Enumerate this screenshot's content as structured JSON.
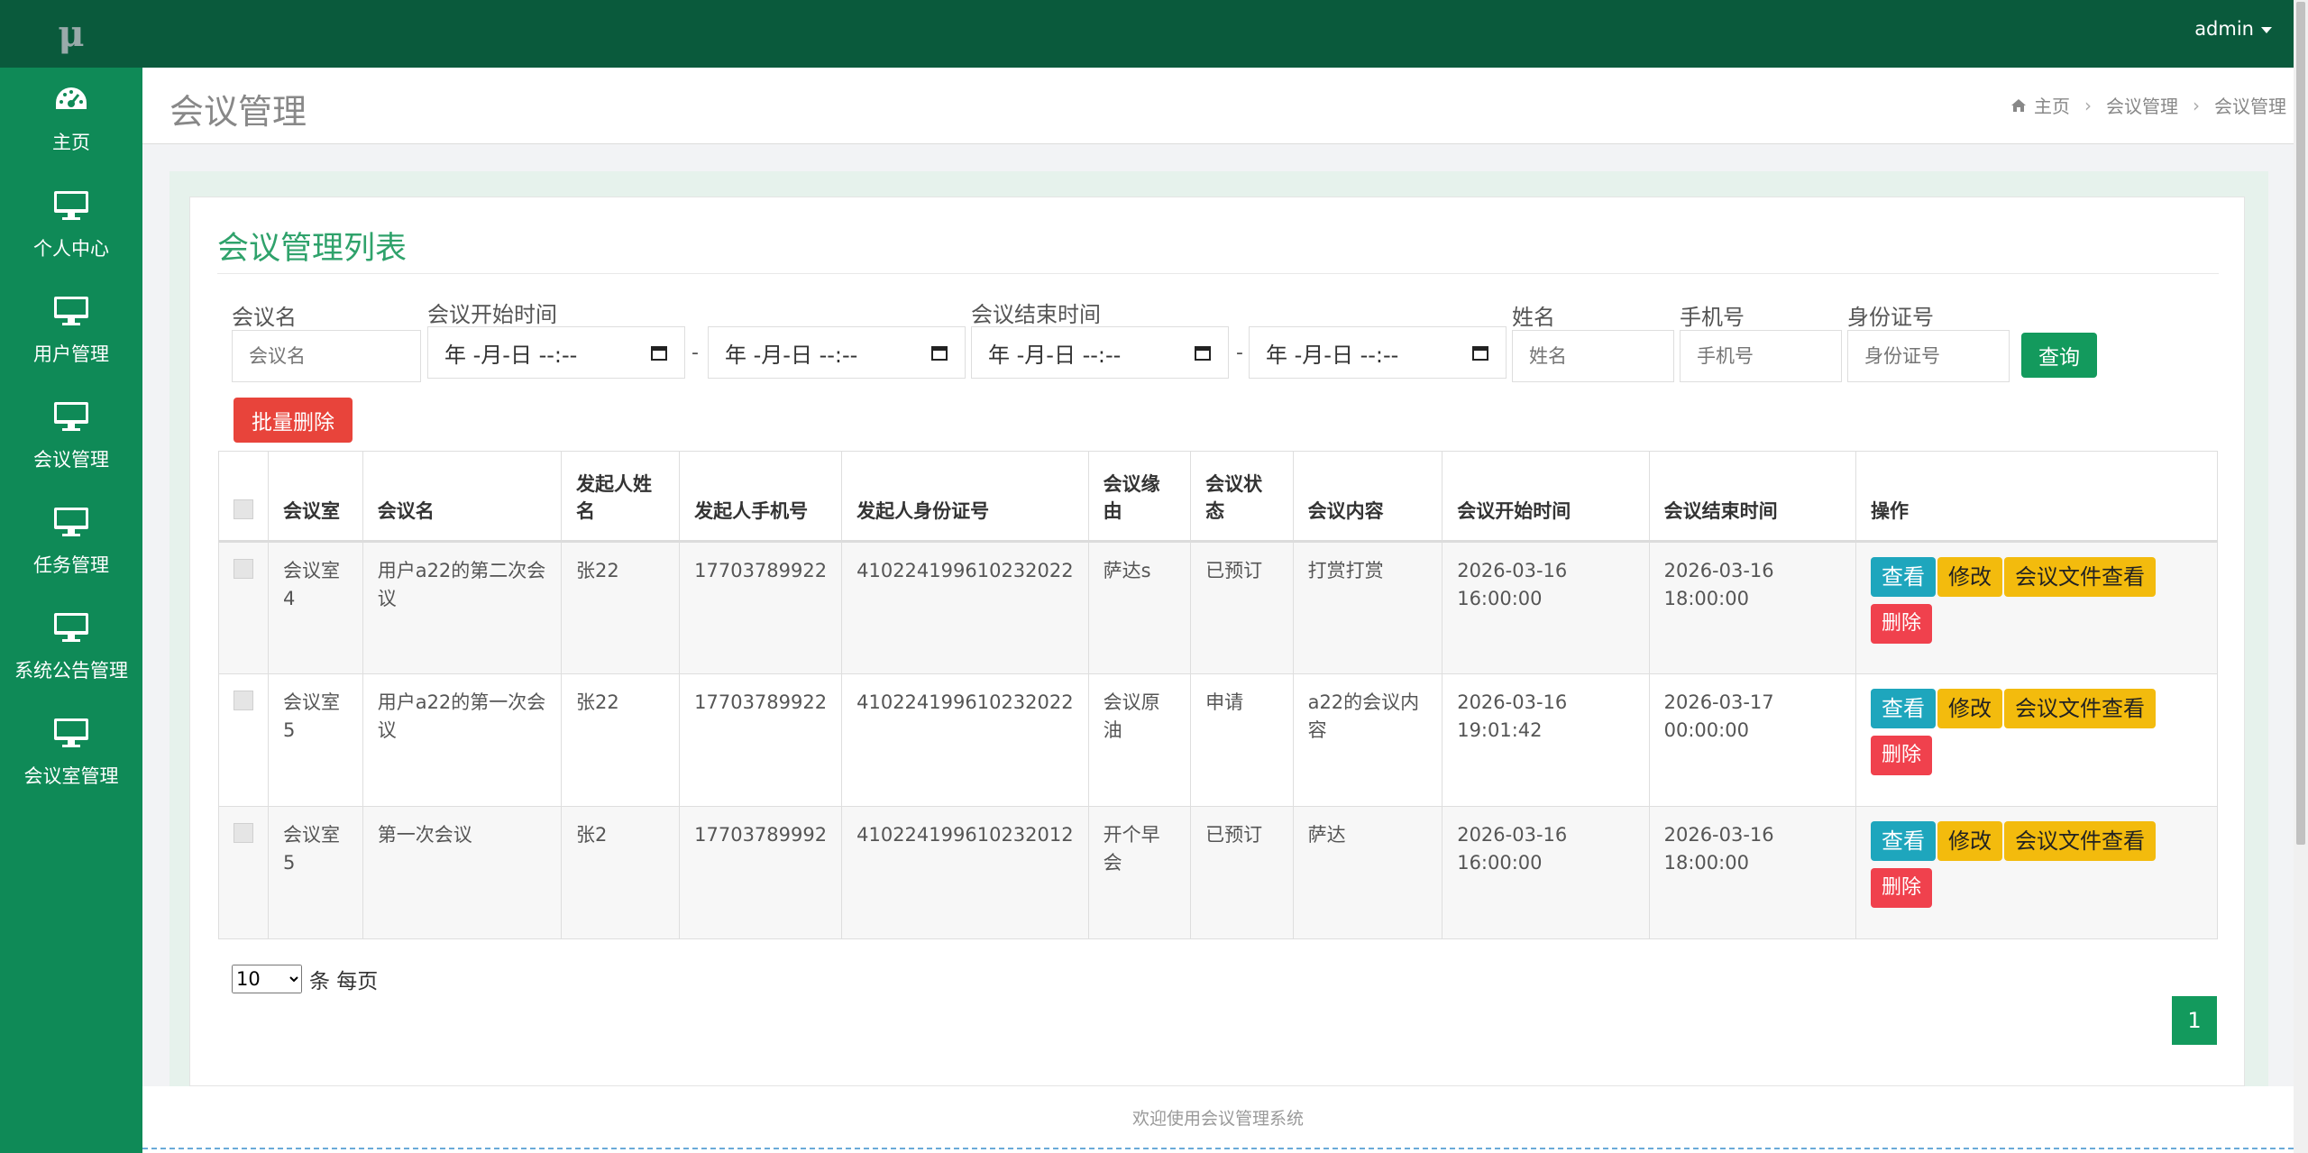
{
  "logo": "μ",
  "sidebar": {
    "items": [
      {
        "label": "主页",
        "icon": "dashboard-icon"
      },
      {
        "label": "个人中心",
        "icon": "monitor-icon"
      },
      {
        "label": "用户管理",
        "icon": "monitor-icon"
      },
      {
        "label": "会议管理",
        "icon": "monitor-icon"
      },
      {
        "label": "任务管理",
        "icon": "monitor-icon"
      },
      {
        "label": "系统公告管理",
        "icon": "monitor-icon"
      },
      {
        "label": "会议室管理",
        "icon": "monitor-icon"
      }
    ]
  },
  "topbar": {
    "user": "admin"
  },
  "header": {
    "title": "会议管理",
    "breadcrumb": [
      "主页",
      "会议管理",
      "会议管理"
    ]
  },
  "card": {
    "title": "会议管理列表"
  },
  "filters": {
    "name_label": "会议名",
    "name_placeholder": "会议名",
    "start_label": "会议开始时间",
    "end_label": "会议结束时间",
    "date_placeholder": "年 -月-日 --:--",
    "range_sep": "-",
    "person_label": "姓名",
    "person_placeholder": "姓名",
    "phone_label": "手机号",
    "phone_placeholder": "手机号",
    "idcard_label": "身份证号",
    "idcard_placeholder": "身份证号",
    "query_button": "查询",
    "bulk_delete_button": "批量删除"
  },
  "table": {
    "headers": [
      "会议室",
      "会议名",
      "发起人姓名",
      "发起人手机号",
      "发起人身份证号",
      "会议缘由",
      "会议状态",
      "会议内容",
      "会议开始时间",
      "会议结束时间",
      "操作"
    ],
    "rows": [
      {
        "room": "会议室4",
        "name": "用户a22的第二次会议",
        "person": "张22",
        "phone": "17703789922",
        "idcard": "410224199610232022",
        "reason": "萨达s",
        "status": "已预订",
        "content": "打赏打赏",
        "start": "2026-03-16 16:00:00",
        "end": "2026-03-16 18:00:00"
      },
      {
        "room": "会议室5",
        "name": "用户a22的第一次会议",
        "person": "张22",
        "phone": "17703789922",
        "idcard": "410224199610232022",
        "reason": "会议原油",
        "status": "申请",
        "content": "a22的会议内容",
        "start": "2026-03-16 19:01:42",
        "end": "2026-03-17 00:00:00"
      },
      {
        "room": "会议室5",
        "name": "第一次会议",
        "person": "张2",
        "phone": "17703789992",
        "idcard": "410224199610232012",
        "reason": "开个早会",
        "status": "已预订",
        "content": "萨达",
        "start": "2026-03-16 16:00:00",
        "end": "2026-03-16 18:00:00"
      }
    ],
    "actions": {
      "view": "查看",
      "edit": "修改",
      "files": "会议文件查看",
      "delete": "删除"
    }
  },
  "pagination": {
    "page_size": "10",
    "per_page_suffix": "条 每页",
    "current_page": "1"
  },
  "footer": "欢迎使用会议管理系统",
  "colors": {
    "sidebar": "#0f8a57",
    "topbar": "#0a5a3c",
    "accent": "#139a5d",
    "danger": "#e8443b",
    "warning": "#f3bb0d",
    "info": "#1ea6bd"
  }
}
